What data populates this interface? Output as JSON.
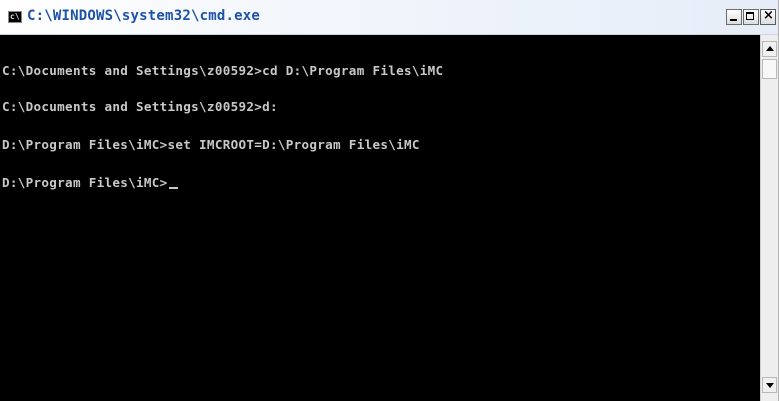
{
  "window": {
    "title": "C:\\WINDOWS\\system32\\cmd.exe",
    "app_icon_label": "c\\",
    "close_glyph": "×"
  },
  "console": {
    "lines": [
      "C:\\Documents and Settings\\z00592>cd D:\\Program Files\\iMC",
      "C:\\Documents and Settings\\z00592>d:",
      "D:\\Program Files\\iMC>set IMCROOT=D:\\Program Files\\iMC",
      "D:\\Program Files\\iMC>"
    ]
  },
  "icons": {
    "app": "cmd-app-icon",
    "minimize": "minimize-icon",
    "maximize": "maximize-icon",
    "close": "close-icon",
    "scroll_up": "scroll-up-arrow-icon",
    "scroll_down": "scroll-down-arrow-icon"
  },
  "colors": {
    "console_bg": "#000000",
    "console_text": "#c8c8c8",
    "title_text": "#1d52a8"
  }
}
